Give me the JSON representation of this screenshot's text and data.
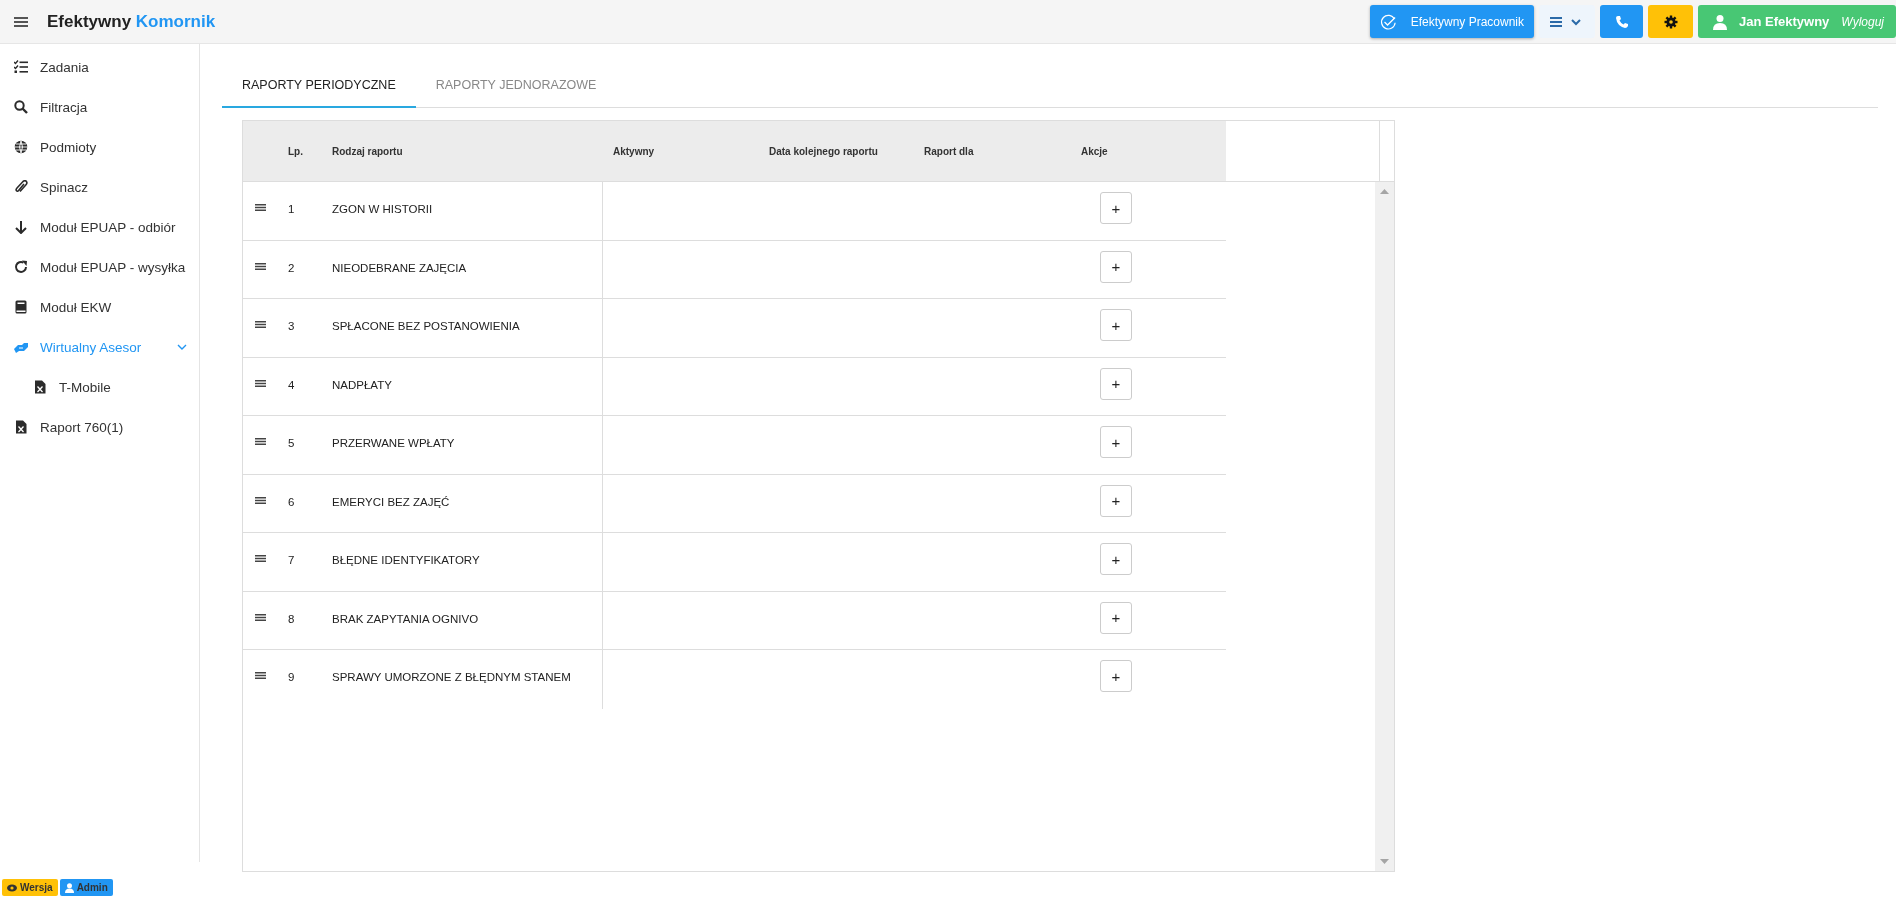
{
  "header": {
    "brand_first": "Efektywny",
    "brand_second": "Komornik",
    "worker_button": "Efektywny Pracownik",
    "user_name": "Jan Efektywny",
    "logout": "Wyloguj"
  },
  "sidebar": {
    "items": [
      {
        "label": "Zadania",
        "kind": "tasks",
        "selected": false
      },
      {
        "label": "Filtracja",
        "kind": "search",
        "selected": false
      },
      {
        "label": "Podmioty",
        "kind": "globe",
        "selected": false
      },
      {
        "label": "Spinacz",
        "kind": "clip",
        "selected": false
      },
      {
        "label": "Moduł EPUAP - odbiór",
        "kind": "down",
        "selected": false
      },
      {
        "label": "Moduł EPUAP - wysyłka",
        "kind": "redo",
        "selected": false
      },
      {
        "label": "Moduł EKW",
        "kind": "book",
        "selected": false
      },
      {
        "label": "Wirtualny Asesor",
        "kind": "hands",
        "selected": true,
        "expanded": true,
        "children": [
          {
            "label": "T-Mobile",
            "kind": "excel",
            "selected": false
          }
        ]
      },
      {
        "label": "Raport 760(1)",
        "kind": "excel",
        "selected": false
      }
    ]
  },
  "tabs": [
    {
      "label": "RAPORTY PERIODYCZNE",
      "selected": true
    },
    {
      "label": "RAPORTY JEDNORAZOWE",
      "selected": false
    }
  ],
  "table": {
    "columns": [
      "Lp.",
      "Rodzaj raportu",
      "Aktywny",
      "Data kolejnego raportu",
      "Raport dla",
      "Akcje"
    ],
    "rows": [
      {
        "lp": "1",
        "name": "ZGON W HISTORII",
        "action": "+"
      },
      {
        "lp": "2",
        "name": "NIEODEBRANE ZAJĘCIA",
        "action": "+"
      },
      {
        "lp": "3",
        "name": "SPŁACONE BEZ POSTANOWIENIA",
        "action": "+"
      },
      {
        "lp": "4",
        "name": "NADPŁATY",
        "action": "+"
      },
      {
        "lp": "5",
        "name": "PRZERWANE WPŁATY",
        "action": "+"
      },
      {
        "lp": "6",
        "name": "EMERYCI BEZ ZAJĘĆ",
        "action": "+"
      },
      {
        "lp": "7",
        "name": "BŁĘDNE IDENTYFIKATORY",
        "action": "+"
      },
      {
        "lp": "8",
        "name": "BRAK ZAPYTANIA OGNIVO",
        "action": "+"
      },
      {
        "lp": "9",
        "name": "SPRAWY UMORZONE Z BŁĘDNYM STANEM",
        "action": "+"
      }
    ]
  },
  "footer_badges": [
    {
      "label": "Wersja",
      "kind": "version"
    },
    {
      "label": "Admin",
      "kind": "admin"
    }
  ]
}
